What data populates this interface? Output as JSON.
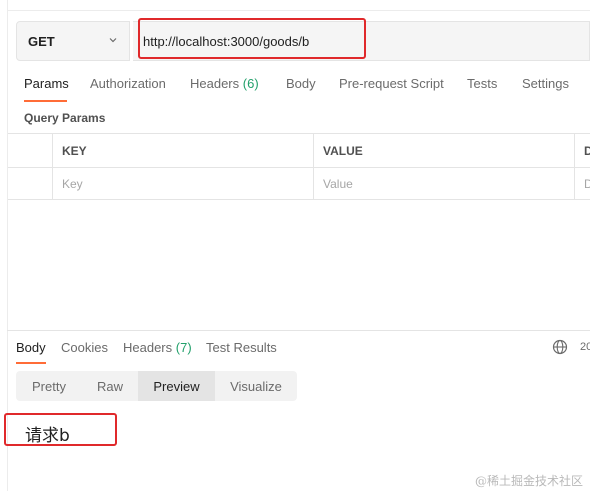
{
  "request": {
    "method": "GET",
    "url": "http://localhost:3000/goods/b"
  },
  "request_tabs": {
    "params": "Params",
    "authorization": "Authorization",
    "headers": "Headers",
    "headers_count": "(6)",
    "body": "Body",
    "prerequest": "Pre-request Script",
    "tests": "Tests",
    "settings": "Settings"
  },
  "query_params": {
    "title": "Query Params",
    "columns": {
      "key": "KEY",
      "value": "VALUE",
      "desc": "D"
    },
    "placeholders": {
      "key": "Key",
      "value": "Value",
      "desc": "D"
    }
  },
  "response_tabs": {
    "body": "Body",
    "cookies": "Cookies",
    "headers": "Headers",
    "headers_count": "(7)",
    "test_results": "Test Results",
    "status_partial": "20"
  },
  "view_modes": {
    "pretty": "Pretty",
    "raw": "Raw",
    "preview": "Preview",
    "visualize": "Visualize"
  },
  "response_body": "请求b",
  "watermark": "@稀土掘金技术社区",
  "colors": {
    "accent": "#ff6c37",
    "highlight": "#e0292b",
    "count_green": "#22a06b"
  }
}
